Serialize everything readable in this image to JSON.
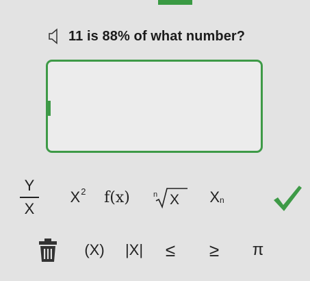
{
  "question": {
    "text": "11 is 88% of what number?",
    "audio_icon": "speaker-icon"
  },
  "answer": {
    "value": ""
  },
  "keypad": {
    "fraction": {
      "numerator": "Y",
      "denominator": "X"
    },
    "power": {
      "base": "X",
      "exponent": "2"
    },
    "function": {
      "label": "f(x)"
    },
    "root": {
      "index": "n",
      "radicand": "X"
    },
    "subscript": {
      "base": "X",
      "sub": "n"
    },
    "submit_icon": "checkmark-icon",
    "clear_icon": "trash-icon",
    "parentheses": "(X)",
    "absolute": "|X|",
    "less_equal": "≤",
    "greater_equal": "≥",
    "pi": "π"
  },
  "colors": {
    "accent": "#3e9a47",
    "background": "#e3e3e3"
  }
}
